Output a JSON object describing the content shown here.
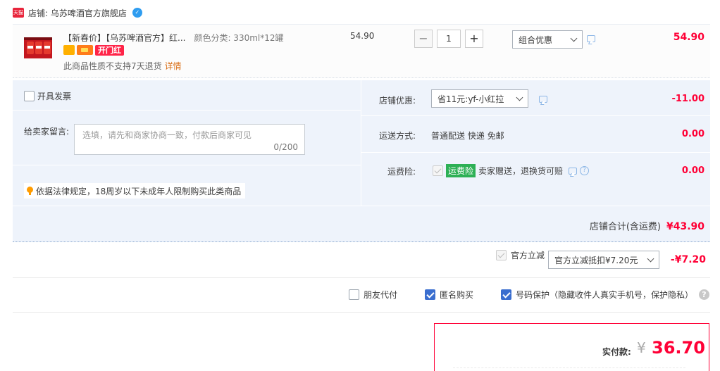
{
  "shop": {
    "badge": "天猫",
    "label": "店铺: 乌苏啤酒官方旗舰店"
  },
  "item": {
    "title": "【新春价】【乌苏啤酒官方】红...",
    "sku": "颜色分类: 330ml*12罐",
    "badge_red": "开门红",
    "no_return": "此商品性质不支持7天退货",
    "detail_link": "详情",
    "unit_price": "54.90",
    "quantity": "1",
    "minus": "−",
    "plus": "+",
    "combo_select": "组合优惠",
    "total": "54.90"
  },
  "panel": {
    "invoice_label": "开具发票",
    "message_label": "给卖家留言:",
    "message_placeholder": "选填，请先和商家协商一致，付款后商家可见",
    "message_count": "0/200",
    "law_notice": "依据法律规定，18周岁以下未成年人限制购买此类商品",
    "shop_discount_label": "店铺优惠:",
    "shop_discount_value": "省11元:yf-小红拉",
    "shop_discount_amount": "-11.00",
    "shipping_label": "运送方式:",
    "shipping_value": "普通配送 快递 免邮",
    "shipping_amount": "0.00",
    "insurance_label": "运费险:",
    "insurance_tag": "运费险",
    "insurance_desc": "卖家赠送，退换货可赔",
    "insurance_amount": "0.00",
    "shop_total_label": "店铺合计(含运费)",
    "shop_total_amount": "¥43.90"
  },
  "official": {
    "label": "官方立减",
    "select": "官方立减抵扣¥7.20元",
    "amount": "-¥7.20"
  },
  "options": {
    "friend_pay": "朋友代付",
    "anonymous": "匿名购买",
    "privacy": "号码保护（隐藏收件人真实手机号，保护隐私）",
    "help": "?"
  },
  "pay": {
    "label": "实付款:",
    "currency": "¥",
    "amount": "36.70"
  },
  "colors": {
    "accent": "#ff0036",
    "panel_bg": "#eef3fb",
    "checkbox": "#3a6ecf"
  }
}
